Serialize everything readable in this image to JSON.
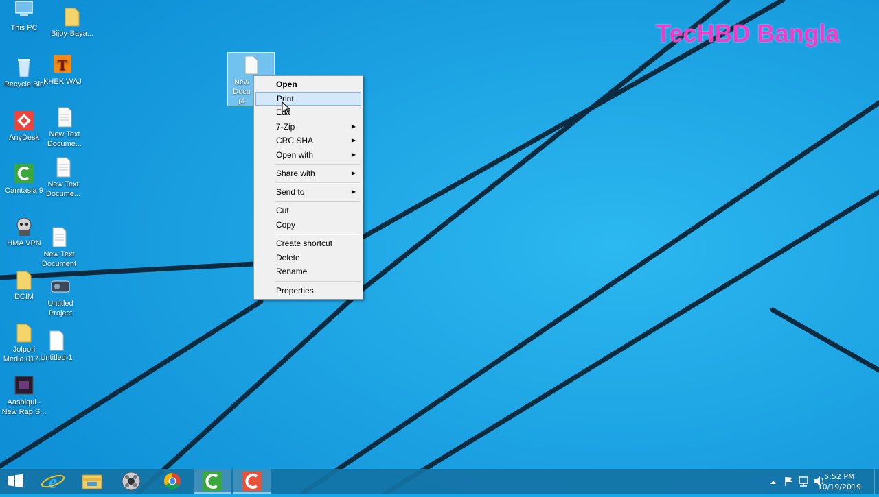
{
  "watermark": "TecHBD Bangla",
  "desktop_icons": [
    {
      "label": "This PC"
    },
    {
      "label": "Bijoy-Baya..."
    },
    {
      "label": "Recycle Bin"
    },
    {
      "label": "KHEK WAJ"
    },
    {
      "label": "AnyDesk"
    },
    {
      "label": "New Text Docume..."
    },
    {
      "label": "Camtasia 9"
    },
    {
      "label": "New Text Docume..."
    },
    {
      "label": "HMA VPN"
    },
    {
      "label": "New Text Document"
    },
    {
      "label": "DCIM"
    },
    {
      "label": "Untitled Project"
    },
    {
      "label": "Jolpori Media,017..."
    },
    {
      "label": "Untitled-1"
    },
    {
      "label": "Aashiqui - New Rap S..."
    }
  ],
  "selected_icon": {
    "label": "New Docu (4"
  },
  "context_menu": {
    "items": [
      {
        "label": "Open"
      },
      {
        "label": "Print"
      },
      {
        "label": "Edit"
      },
      {
        "label": "7-Zip"
      },
      {
        "label": "CRC SHA"
      },
      {
        "label": "Open with"
      },
      {
        "label": "Share with"
      },
      {
        "label": "Send to"
      },
      {
        "label": "Cut"
      },
      {
        "label": "Copy"
      },
      {
        "label": "Create shortcut"
      },
      {
        "label": "Delete"
      },
      {
        "label": "Rename"
      },
      {
        "label": "Properties"
      }
    ]
  },
  "taskbar": {
    "apps": [
      "start-icon",
      "internet-explorer-icon",
      "file-explorer-icon",
      "media-player-icon",
      "chrome-icon",
      "camtasia-icon",
      "camtasia-recorder-icon"
    ],
    "time": "5:52 PM",
    "date": "10/19/2019"
  },
  "colors": {
    "wallpaper": "#19a6e6",
    "watermark": "#f03cc8",
    "highlight": "#d5e8f9"
  }
}
